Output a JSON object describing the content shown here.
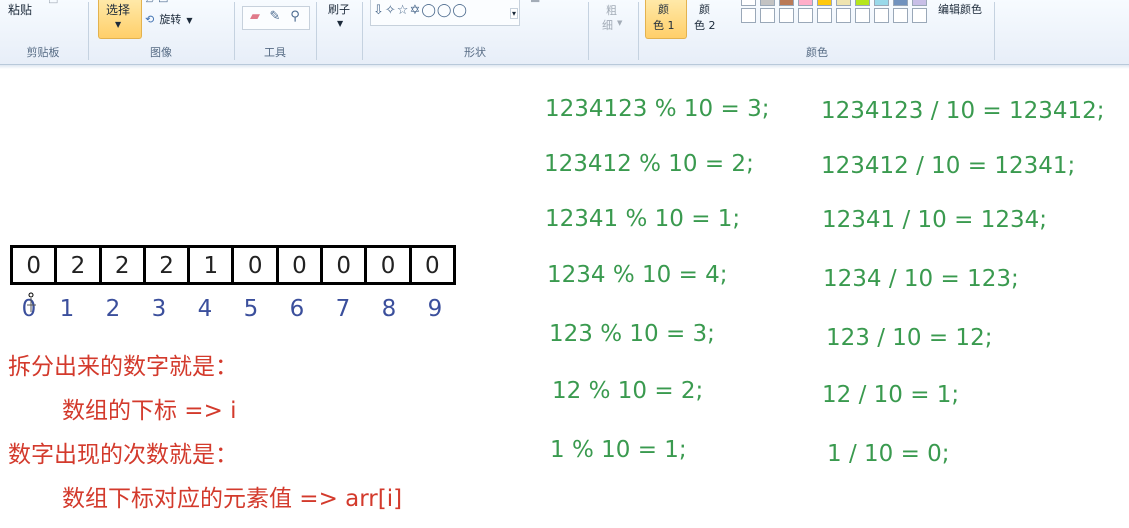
{
  "ribbon": {
    "clipboard": {
      "paste_label": "粘贴",
      "group_label": "剪贴板"
    },
    "image": {
      "select_label": "选择",
      "rotate_label": "旋转",
      "group_label": "图像"
    },
    "tools": {
      "group_label": "工具",
      "icons": [
        "eraser-icon",
        "color-picker-icon",
        "magnifier-icon"
      ]
    },
    "brushes": {
      "label": "刷子"
    },
    "shapes": {
      "row": "⇩✧☆✡◯◯◯",
      "group_label": "形状"
    },
    "size": {
      "label_top": "粗",
      "label_bottom": "细"
    },
    "color1": {
      "label_top": "颜",
      "label_bottom": "色 1"
    },
    "color2": {
      "label_top": "颜",
      "label_bottom": "色 2"
    },
    "edit_colors_label": "编辑颜色",
    "colors_group_label": "颜色",
    "palette_top": [
      "#ffffff",
      "#c3c3c3",
      "#b97a57",
      "#ffaec9",
      "#ffc90e",
      "#efe4b0",
      "#b5e61d",
      "#99d9ea",
      "#7092be",
      "#c8bfe7"
    ]
  },
  "canvas": {
    "modulo_lines": [
      "1234123 % 10 = 3;",
      "123412 % 10 = 2;",
      "12341 % 10 = 1;",
      "1234 % 10 = 4;",
      "123 % 10 = 3;",
      "12 % 10 = 2;",
      "1 % 10 = 1;"
    ],
    "division_lines": [
      "1234123 / 10 = 123412;",
      "123412 / 10 = 12341;",
      "12341 / 10 = 1234;",
      "1234 / 10 = 123;",
      "123 / 10 = 12;",
      "12 / 10 = 1;",
      "1 / 10 = 0;"
    ],
    "array_values": [
      "0",
      "2",
      "2",
      "2",
      "1",
      "0",
      "0",
      "0",
      "0",
      "0"
    ],
    "array_indices": [
      "0",
      "1",
      "2",
      "3",
      "4",
      "5",
      "6",
      "7",
      "8",
      "9"
    ],
    "notes": {
      "line1": "拆分出来的数字就是：",
      "line2": "数组的下标   => i",
      "line3": "数字出现的次数就是：",
      "line4": "数组下标对应的元素值  => arr[i]"
    }
  }
}
